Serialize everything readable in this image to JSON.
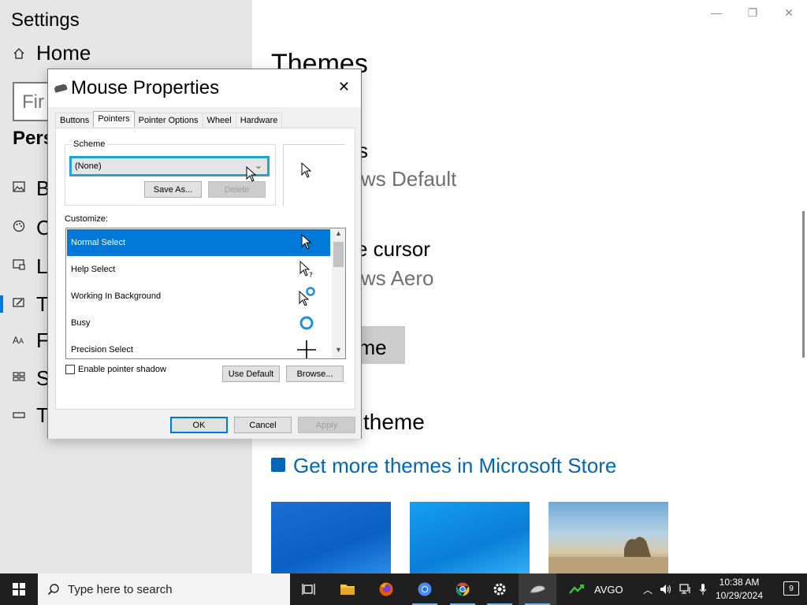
{
  "settings": {
    "app_title": "Settings",
    "home_label": "Home",
    "search_placeholder_partial": "Fir",
    "section_partial": "Pers",
    "nav": [
      {
        "icon": "image-icon",
        "label_partial": "B"
      },
      {
        "icon": "palette-icon",
        "label_partial": "C"
      },
      {
        "icon": "lock-screen-icon",
        "label_partial": "L"
      },
      {
        "icon": "themes-icon",
        "label_partial": "T",
        "selected": true
      },
      {
        "icon": "font-icon",
        "label_partial": "F"
      },
      {
        "icon": "start-icon",
        "label_partial": "S"
      },
      {
        "icon": "taskbar-icon",
        "label_partial": "T"
      }
    ],
    "window_controls": {
      "minimize": "—",
      "restore": "❐",
      "close": "✕"
    },
    "main": {
      "title": "Themes",
      "background_partial": "s",
      "background_value_partial": "ws Default",
      "cursor_label_partial": "e cursor",
      "cursor_value_partial": "ws Aero",
      "use_theme_partial": "eme",
      "change_theme_partial": "theme",
      "store_link": "Get more themes in Microsoft Store"
    }
  },
  "dialog": {
    "title": "Mouse Properties",
    "close": "✕",
    "tabs": [
      "Buttons",
      "Pointers",
      "Pointer Options",
      "Wheel",
      "Hardware"
    ],
    "active_tab": "Pointers",
    "scheme_label": "Scheme",
    "scheme_value": "(None)",
    "save_as": "Save As...",
    "delete": "Delete",
    "customize_label": "Customize:",
    "cursors": [
      {
        "name": "Normal Select",
        "icon": "arrow-cursor-icon",
        "selected": true
      },
      {
        "name": "Help Select",
        "icon": "help-cursor-icon"
      },
      {
        "name": "Working In Background",
        "icon": "working-cursor-icon"
      },
      {
        "name": "Busy",
        "icon": "busy-cursor-icon"
      },
      {
        "name": "Precision Select",
        "icon": "crosshair-cursor-icon"
      }
    ],
    "enable_shadow": "Enable pointer shadow",
    "use_default": "Use Default",
    "browse": "Browse...",
    "ok": "OK",
    "cancel": "Cancel",
    "apply": "Apply"
  },
  "taskbar": {
    "search_placeholder": "Type here to search",
    "stock_symbol": "AVGO",
    "time": "10:38 AM",
    "date": "10/29/2024",
    "notification_count": "9"
  },
  "colors": {
    "accent": "#0078d7",
    "link": "#0067b8",
    "scheme_highlight": "#22a5d4"
  }
}
